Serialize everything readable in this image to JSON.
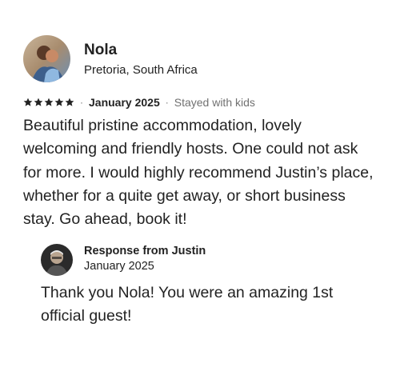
{
  "review": {
    "reviewer_name": "Nola",
    "reviewer_location": "Pretoria, South Africa",
    "rating": 5,
    "date": "January 2025",
    "trip_type": "Stayed with kids",
    "body": "Beautiful pristine accommodation, lovely welcoming and friendly hosts. One could not ask for more. I would highly recommend Justin’s place, whether for a quite get away, or short business stay. Go ahead, book it!"
  },
  "response": {
    "title": "Response from Justin",
    "date": "January 2025",
    "body": "Thank you Nola! You were an amazing 1st official guest!"
  },
  "colors": {
    "text": "#222222",
    "secondary": "#717171",
    "background": "#ffffff"
  },
  "icons": {
    "star": "star-icon"
  }
}
